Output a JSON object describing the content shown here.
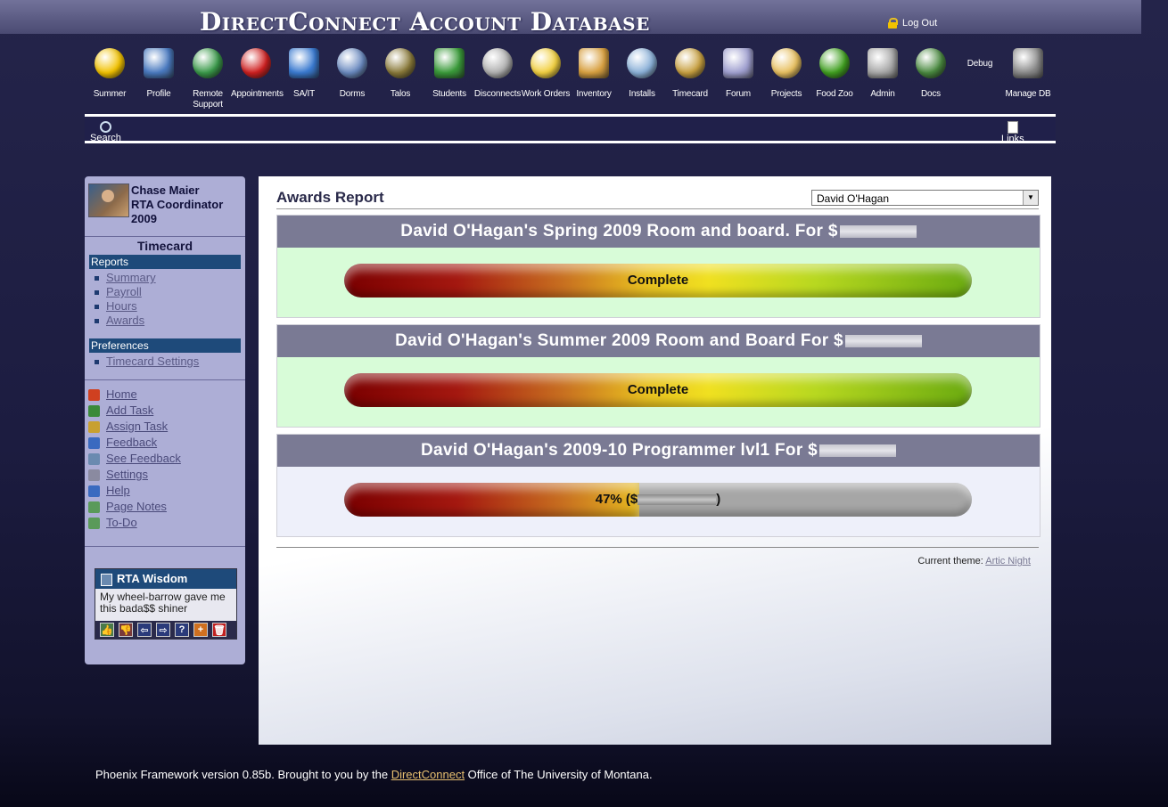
{
  "app": {
    "title": "DirectConnect Account Database",
    "logout": "Log Out"
  },
  "nav": [
    {
      "label": "Summer",
      "icon": "smiley-icon",
      "color": "#f2c200"
    },
    {
      "label": "Profile",
      "icon": "profile-icon",
      "color": "#4a7ac0"
    },
    {
      "label": "Remote Support",
      "icon": "globe-help-icon",
      "color": "#3a9a4a"
    },
    {
      "label": "Appointments",
      "icon": "alarm-clock-icon",
      "color": "#d02020"
    },
    {
      "label": "SA/IT",
      "icon": "medical-cross-icon",
      "color": "#3a7ad0"
    },
    {
      "label": "Dorms",
      "icon": "building-icon",
      "color": "#6a8ac0"
    },
    {
      "label": "Talos",
      "icon": "helmet-icon",
      "color": "#8a7a3a"
    },
    {
      "label": "Students",
      "icon": "student-icon",
      "color": "#3a9a3a"
    },
    {
      "label": "Disconnects",
      "icon": "disconnect-plug-icon",
      "color": "#b0b0b0"
    },
    {
      "label": "Work Orders",
      "icon": "work-order-icon",
      "color": "#f2d040"
    },
    {
      "label": "Inventory",
      "icon": "box-icon",
      "color": "#d8a040"
    },
    {
      "label": "Installs",
      "icon": "install-icon",
      "color": "#8ab0d8"
    },
    {
      "label": "Timecard",
      "icon": "money-bag-icon",
      "color": "#c8a040"
    },
    {
      "label": "Forum",
      "icon": "forum-bubble-icon",
      "color": "#a0a0d0"
    },
    {
      "label": "Projects",
      "icon": "folder-icon",
      "color": "#e8c060"
    },
    {
      "label": "Food Zoo",
      "icon": "apple-icon",
      "color": "#40a020"
    },
    {
      "label": "Admin",
      "icon": "admin-gears-icon",
      "color": "#a8a8a8"
    },
    {
      "label": "Docs",
      "icon": "books-icon",
      "color": "#4a8a40"
    },
    {
      "label": "Debug",
      "icon": "",
      "color": ""
    },
    {
      "label": "Manage DB",
      "icon": "database-check-icon",
      "color": "#8a8a8a"
    }
  ],
  "tools": {
    "search": "Search",
    "links": "Links"
  },
  "sidebar": {
    "user": {
      "name": "Chase Maier",
      "role": "RTA Coordinator",
      "year": "2009"
    },
    "section_title": "Timecard",
    "reports_head": "Reports",
    "reports": [
      "Summary",
      "Payroll",
      "Hours",
      "Awards"
    ],
    "prefs_head": "Preferences",
    "prefs": [
      "Timecard Settings"
    ],
    "links": [
      {
        "label": "Home",
        "icon": "home-icon",
        "color": "#d04020"
      },
      {
        "label": "Add Task",
        "icon": "add-task-icon",
        "color": "#3a8a3a"
      },
      {
        "label": "Assign Task",
        "icon": "assign-task-icon",
        "color": "#c8a030"
      },
      {
        "label": "Feedback",
        "icon": "info-icon",
        "color": "#3a6ac0"
      },
      {
        "label": "See Feedback",
        "icon": "magnifier-icon",
        "color": "#6a8ab0"
      },
      {
        "label": "Settings",
        "icon": "tools-icon",
        "color": "#8a8aa0"
      },
      {
        "label": "Help",
        "icon": "help-icon",
        "color": "#3a6ac0"
      },
      {
        "label": " Page Notes",
        "icon": "notes-icon",
        "color": "#5a9a5a"
      },
      {
        "label": "To-Do",
        "icon": "todo-icon",
        "color": "#5a9a5a"
      }
    ],
    "wisdom": {
      "title": "RTA Wisdom",
      "text": "My wheel-barrow gave me this bada$$ shiner",
      "buttons": [
        "👍",
        "👎",
        "⇦",
        "⇨",
        "?",
        "+",
        "🗑"
      ]
    }
  },
  "main": {
    "title": "Awards Report",
    "selected_user": "David O'Hagan",
    "awards": [
      {
        "title": "David O'Hagan's Spring 2009 Room and board. For $",
        "status": "Complete",
        "progress": 100,
        "bg": "#d8fcd8"
      },
      {
        "title": "David O'Hagan's Summer 2009 Room and Board For $",
        "status": "Complete",
        "progress": 100,
        "bg": "#d8fcd8"
      },
      {
        "title": "David O'Hagan's 2009-10 Programmer lvl1 For $",
        "status": "47% ($",
        "status_suffix": ")",
        "progress": 47,
        "bg": "#eef0fa"
      }
    ],
    "theme_label": "Current theme:",
    "theme_name": "Artic Night"
  },
  "footer": {
    "prefix": "Phoenix Framework version 0.85b. Brought to you by the ",
    "link": "DirectConnect",
    "suffix": " Office of The University of Montana."
  }
}
